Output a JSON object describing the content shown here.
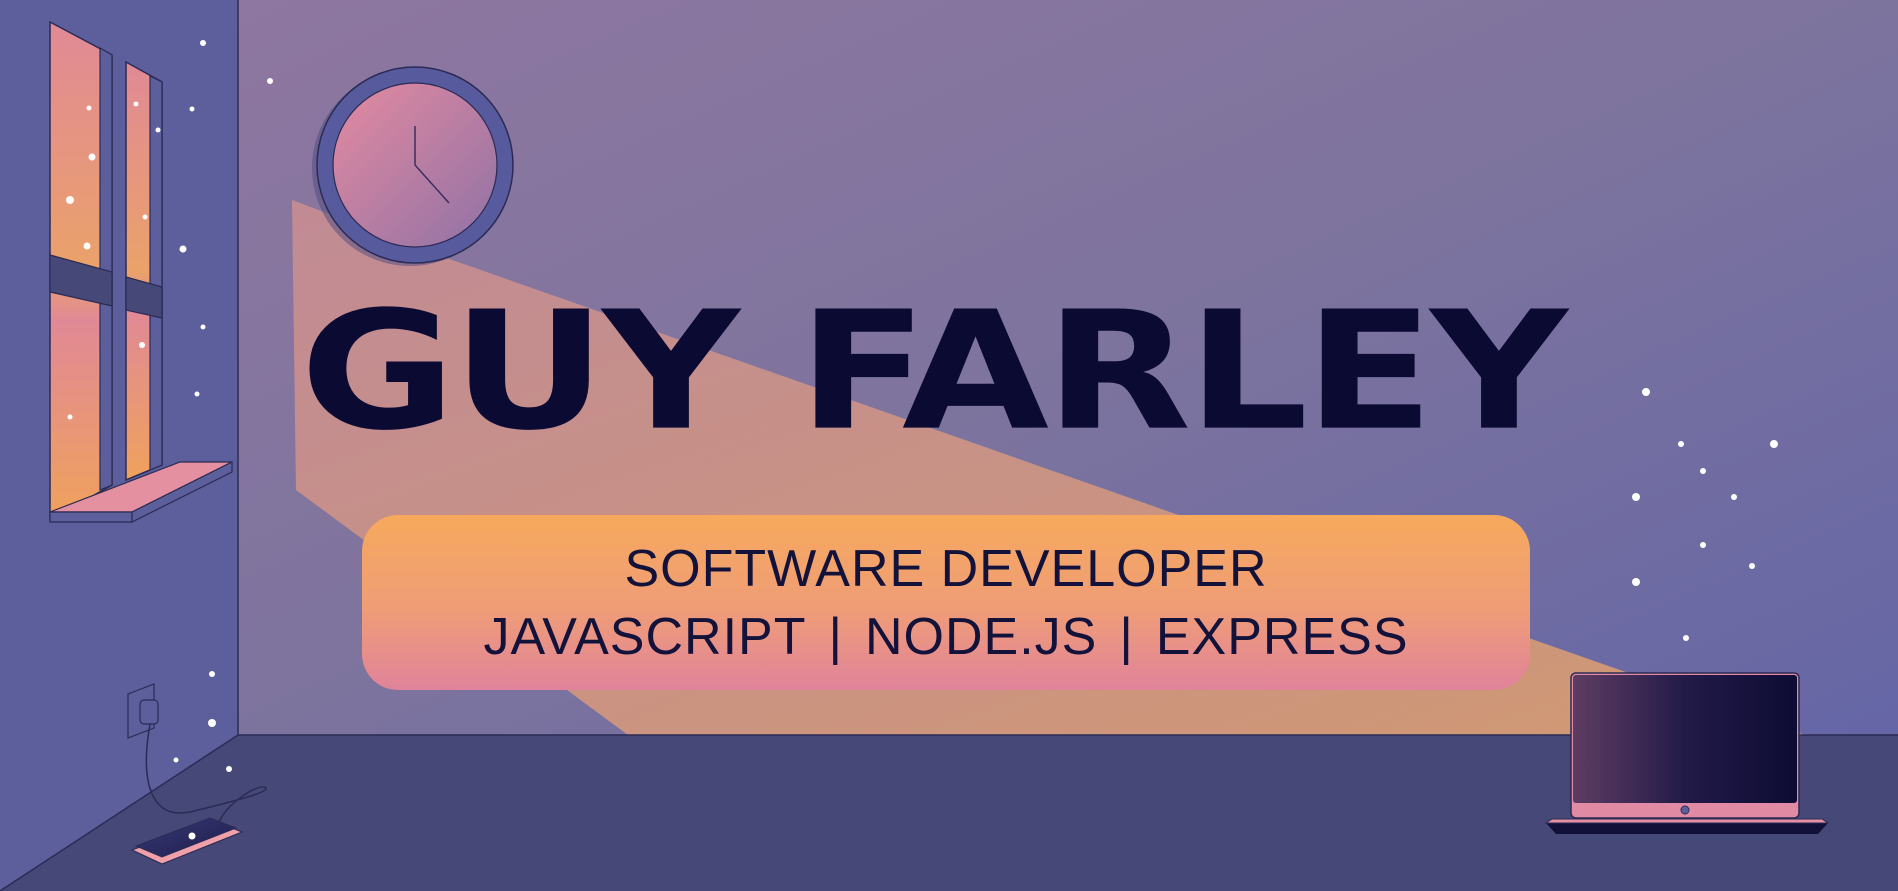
{
  "header": {
    "name": "GUY FARLEY"
  },
  "banner": {
    "role": "SOFTWARE DEVELOPER",
    "skills": [
      "JAVASCRIPT",
      "NODE.JS",
      "EXPRESS"
    ],
    "separator": "|"
  },
  "colors": {
    "wall_top": "#8a7a9e",
    "wall_right": "#6b69a6",
    "floor": "#464878",
    "side_wall": "#5c5f9c",
    "title": "#0b0a32",
    "banner_top": "#f6a95c",
    "banner_bottom": "#e0839b",
    "light_beam": "#f0a676"
  },
  "icons": [
    "clock-icon",
    "window-icon",
    "laptop-icon",
    "phone-icon",
    "wall-outlet-icon"
  ]
}
